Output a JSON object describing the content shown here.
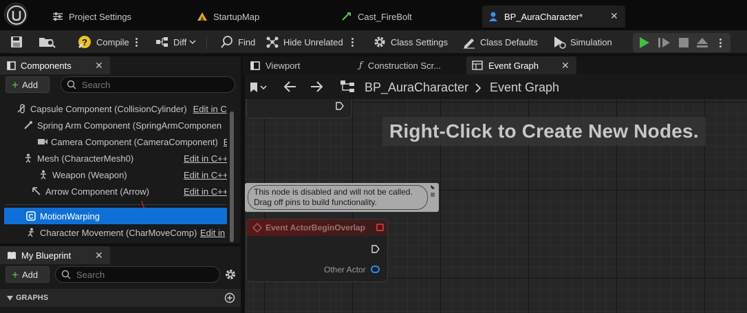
{
  "tabs": [
    {
      "label": "Project Settings",
      "active": false
    },
    {
      "label": "StartupMap",
      "active": false
    },
    {
      "label": "Cast_FireBolt",
      "active": false
    },
    {
      "label": "BP_AuraCharacter*",
      "active": true
    }
  ],
  "toolbar": {
    "compile": "Compile",
    "diff": "Diff",
    "find": "Find",
    "hide_unrelated": "Hide Unrelated",
    "class_settings": "Class Settings",
    "class_defaults": "Class Defaults",
    "simulation": "Simulation"
  },
  "components": {
    "title": "Components",
    "add_label": "Add",
    "search_placeholder": "Search",
    "items": [
      {
        "label": "Capsule Component (CollisionCylinder)",
        "edit": "Edit in C"
      },
      {
        "label": "Spring Arm Component (SpringArmComponen",
        "edit": ""
      },
      {
        "label": "Camera Component (CameraComponent)",
        "edit": "E"
      },
      {
        "label": "Mesh (CharacterMesh0)",
        "edit": "Edit in C++"
      },
      {
        "label": "Weapon (Weapon)",
        "edit": "Edit in C++"
      },
      {
        "label": "Arrow Component (Arrow)",
        "edit": "Edit in C++"
      },
      {
        "label": "MotionWarping",
        "edit": ""
      },
      {
        "label": "Character Movement (CharMoveComp)",
        "edit": "Edit in"
      }
    ]
  },
  "my_blueprint": {
    "title": "My Blueprint",
    "add_label": "Add",
    "search_placeholder": "Search",
    "graphs_header": "GRAPHS"
  },
  "graph_tabs": [
    {
      "label": "Viewport",
      "active": false
    },
    {
      "label": "Construction Scr...",
      "active": false
    },
    {
      "label": "Event Graph",
      "active": true
    }
  ],
  "breadcrumb": {
    "root": "BP_AuraCharacter",
    "current": "Event Graph"
  },
  "graph": {
    "hint": "Right-Click to Create New Nodes.",
    "disabled_note_line1": "This node is disabled and will not be called.",
    "disabled_note_line2": "Drag off pins to build functionality.",
    "node_title": "Event ActorBeginOverlap",
    "node_pin": "Other Actor"
  },
  "colors": {
    "selection": "#0e70d6",
    "add_plus": "#6ac34a",
    "play_green": "#3fbf3f",
    "event_node_red": "#b42828",
    "pin_blue": "#1f8ff0"
  }
}
